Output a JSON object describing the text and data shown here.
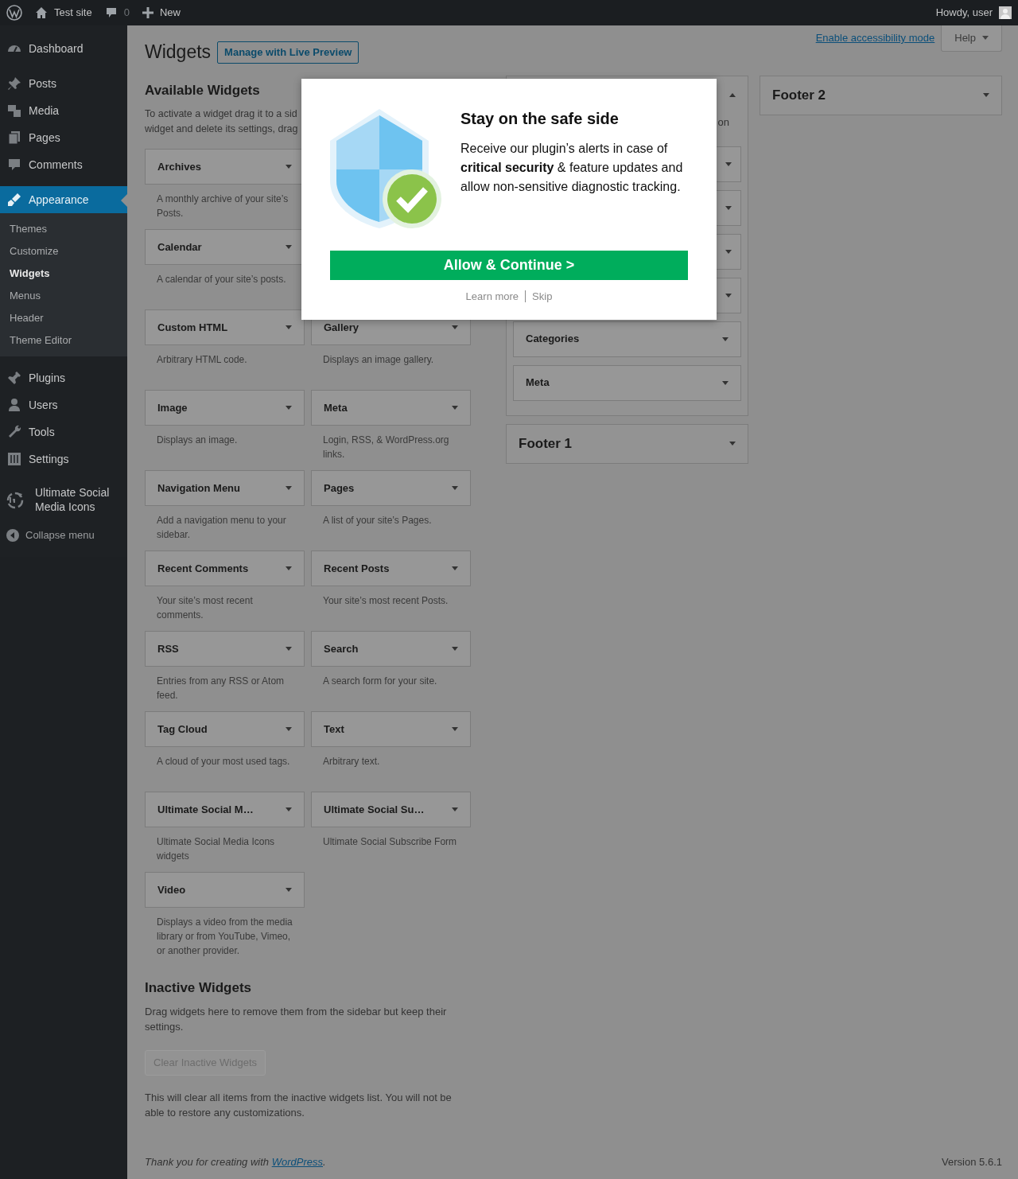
{
  "admin_bar": {
    "site": "Test site",
    "comments": "0",
    "new": "New",
    "howdy": "Howdy, user"
  },
  "menu": [
    {
      "label": "Dashboard",
      "selected": false
    },
    {
      "label": "Posts",
      "selected": false
    },
    {
      "label": "Media",
      "selected": false
    },
    {
      "label": "Pages",
      "selected": false
    },
    {
      "label": "Comments",
      "selected": false
    },
    {
      "label": "Appearance",
      "selected": true,
      "children": [
        {
          "label": "Themes",
          "selected": false
        },
        {
          "label": "Customize",
          "selected": false
        },
        {
          "label": "Widgets",
          "selected": true
        },
        {
          "label": "Menus",
          "selected": false
        },
        {
          "label": "Header",
          "selected": false
        },
        {
          "label": "Theme Editor",
          "selected": false
        }
      ]
    },
    {
      "label": "Plugins",
      "selected": false
    },
    {
      "label": "Users",
      "selected": false
    },
    {
      "label": "Tools",
      "selected": false
    },
    {
      "label": "Settings",
      "selected": false
    },
    {
      "label": "Ultimate Social Media Icons",
      "selected": false
    }
  ],
  "collapse": "Collapse menu",
  "screen_links": {
    "accessibility": "Enable accessibility mode",
    "help": "Help"
  },
  "title": "Widgets",
  "live_preview": "Manage with Live Preview",
  "available": {
    "heading": "Available Widgets",
    "description_lines": [
      "To activate a widget drag it to a sid",
      "widget and delete its settings, drag"
    ],
    "rows": [
      {
        "left": {
          "title": "Archives",
          "description": "A monthly archive of your site’s Posts."
        }
      },
      {
        "left": {
          "title": "Calendar",
          "description": "A calendar of your site’s posts."
        }
      },
      {
        "left": {
          "title": "Custom HTML",
          "description": "Arbitrary HTML code."
        },
        "right": {
          "title": "Gallery",
          "description": "Displays an image gallery."
        }
      },
      {
        "left": {
          "title": "Image",
          "description": "Displays an image."
        },
        "right": {
          "title": "Meta",
          "description": "Login, RSS, & WordPress.org links."
        }
      },
      {
        "left": {
          "title": "Navigation Menu",
          "description": "Add a navigation menu to your sidebar."
        },
        "right": {
          "title": "Pages",
          "description": "A list of your site’s Pages."
        }
      },
      {
        "left": {
          "title": "Recent Comments",
          "description": "Your site’s most recent comments."
        },
        "right": {
          "title": "Recent Posts",
          "description": "Your site’s most recent Posts."
        }
      },
      {
        "left": {
          "title": "RSS",
          "description": "Entries from any RSS or Atom feed."
        },
        "right": {
          "title": "Search",
          "description": "A search form for your site."
        }
      },
      {
        "left": {
          "title": "Tag Cloud",
          "description": "A cloud of your most used tags."
        },
        "right": {
          "title": "Text",
          "description": "Arbitrary text."
        }
      },
      {
        "left": {
          "title": "Ultimate Social M…",
          "description": "Ultimate Social Media Icons widgets"
        },
        "right": {
          "title": "Ultimate Social Su…",
          "description": "Ultimate Social Subscribe Form"
        }
      },
      {
        "left": {
          "title": "Video",
          "description": "Displays a video from the media library or from YouTube, Vimeo, or another provider."
        }
      }
    ]
  },
  "sidebar_columns": [
    [
      {
        "expanded": true,
        "description": "on",
        "widgets": [
          {
            "kind": "covered"
          },
          {
            "kind": "covered"
          },
          {
            "kind": "covered"
          },
          {
            "kind": "covered"
          },
          {
            "kind": "widget",
            "title": "Categories"
          },
          {
            "kind": "widget",
            "title": "Meta"
          }
        ]
      },
      {
        "expanded": false,
        "title": "Footer 1"
      }
    ],
    [
      {
        "expanded": false,
        "title": "Footer 2"
      }
    ]
  ],
  "inactive": {
    "heading": "Inactive Widgets",
    "description": "Drag widgets here to remove them from the sidebar but keep their settings.",
    "button": "Clear Inactive Widgets",
    "button_disabled": true,
    "note": "This will clear all items from the inactive widgets list. You will not be able to restore any customizations."
  },
  "footer": {
    "before": "Thank you for creating with ",
    "link": "WordPress",
    "after": ".",
    "version": "Version 5.6.1"
  },
  "modal": {
    "title": "Stay on the safe side",
    "text": "Receive our plugin’s alerts in case of **critical security** & feature updates and allow non-sensitive diagnostic tracking.",
    "button": "Allow & Continue >",
    "links": [
      "Learn more",
      "Skip"
    ]
  }
}
